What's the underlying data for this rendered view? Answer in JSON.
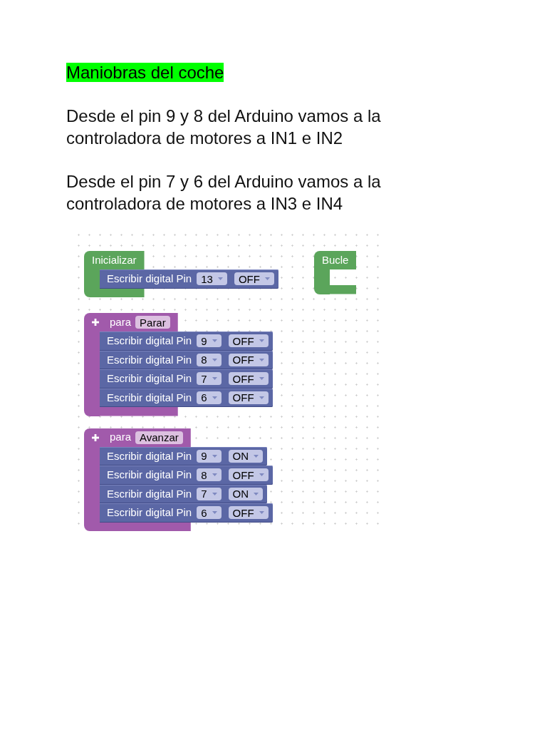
{
  "document": {
    "title": "Maniobras del coche",
    "paragraphs": [
      "Desde el pin 9 y 8 del Arduino vamos a la controladora de motores a IN1 e IN2",
      "Desde el pin 7 y 6 del Arduino vamos a la controladora de motores a IN3 e IN4"
    ]
  },
  "workspace": {
    "blocks": [
      {
        "kind": "event",
        "label": "Inicializar",
        "statements": [
          {
            "label": "Escribir digital Pin",
            "pin": "13",
            "value": "OFF"
          }
        ]
      },
      {
        "kind": "event",
        "label": "Bucle"
      },
      {
        "kind": "function",
        "keyword": "para",
        "name": "Parar",
        "statements": [
          {
            "label": "Escribir digital Pin",
            "pin": "9",
            "value": "OFF"
          },
          {
            "label": "Escribir digital Pin",
            "pin": "8",
            "value": "OFF"
          },
          {
            "label": "Escribir digital Pin",
            "pin": "7",
            "value": "OFF"
          },
          {
            "label": "Escribir digital Pin",
            "pin": "6",
            "value": "OFF"
          }
        ]
      },
      {
        "kind": "function",
        "keyword": "para",
        "name": "Avanzar",
        "statements": [
          {
            "label": "Escribir digital Pin",
            "pin": "9",
            "value": "ON"
          },
          {
            "label": "Escribir digital Pin",
            "pin": "8",
            "value": "OFF"
          },
          {
            "label": "Escribir digital Pin",
            "pin": "7",
            "value": "ON"
          },
          {
            "label": "Escribir digital Pin",
            "pin": "6",
            "value": "OFF"
          }
        ]
      }
    ]
  }
}
